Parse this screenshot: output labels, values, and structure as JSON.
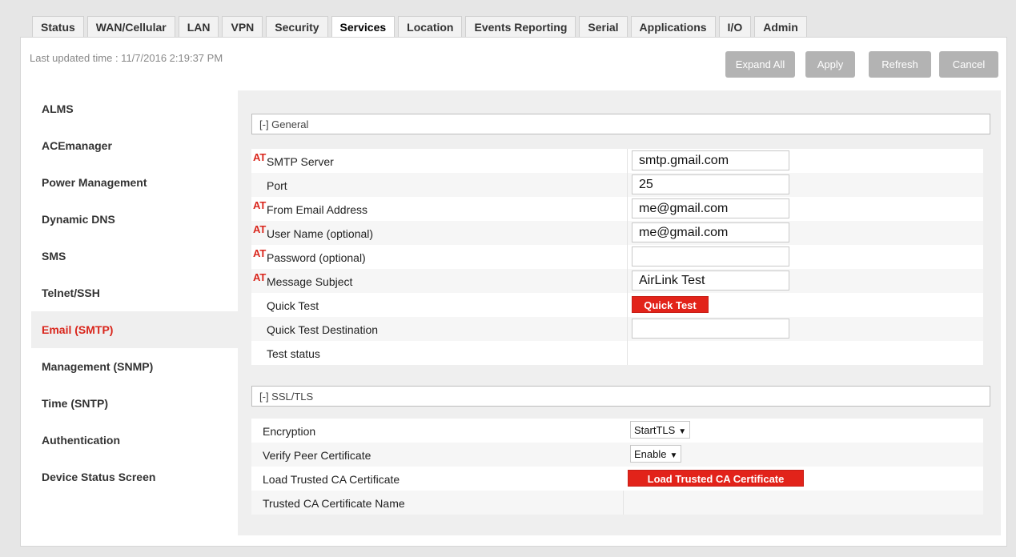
{
  "tabs": [
    "Status",
    "WAN/Cellular",
    "LAN",
    "VPN",
    "Security",
    "Services",
    "Location",
    "Events Reporting",
    "Serial",
    "Applications",
    "I/O",
    "Admin"
  ],
  "active_tab": "Services",
  "toolbar": {
    "last_updated": "Last updated time : 11/7/2016 2:19:37 PM",
    "expand_all": "Expand All",
    "apply": "Apply",
    "refresh": "Refresh",
    "cancel": "Cancel"
  },
  "sidebar": {
    "items": [
      "ALMS",
      "ACEmanager",
      "Power Management",
      "Dynamic DNS",
      "SMS",
      "Telnet/SSH",
      "Email (SMTP)",
      "Management (SNMP)",
      "Time (SNTP)",
      "Authentication",
      "Device Status Screen"
    ],
    "active": "Email (SMTP)"
  },
  "general": {
    "header": "[-] General",
    "at_marker": "AT",
    "rows": [
      {
        "label": "SMTP Server",
        "value": "smtp.gmail.com"
      },
      {
        "label": "Port",
        "value": "25"
      },
      {
        "label": "From Email Address",
        "value": "me@gmail.com"
      },
      {
        "label": "User Name (optional)",
        "value": "me@gmail.com"
      },
      {
        "label": "Password (optional)",
        "value": ""
      },
      {
        "label": "Message Subject",
        "value": "AirLink Test"
      },
      {
        "label": "Quick Test",
        "button": "Quick Test"
      },
      {
        "label": "Quick Test Destination",
        "value": ""
      },
      {
        "label": "Test status",
        "value": ""
      }
    ]
  },
  "ssl": {
    "header": "[-] SSL/TLS",
    "rows": [
      {
        "label": "Encryption",
        "selected": "StartTLS"
      },
      {
        "label": "Verify Peer Certificate",
        "selected": "Enable"
      },
      {
        "label": "Load Trusted CA Certificate",
        "button": "Load Trusted CA Certificate"
      },
      {
        "label": "Trusted CA Certificate Name",
        "value": ""
      }
    ]
  },
  "colors": {
    "accent": "#e2231a",
    "active_text": "#d9261c",
    "button_gray": "#b3b3b3"
  }
}
